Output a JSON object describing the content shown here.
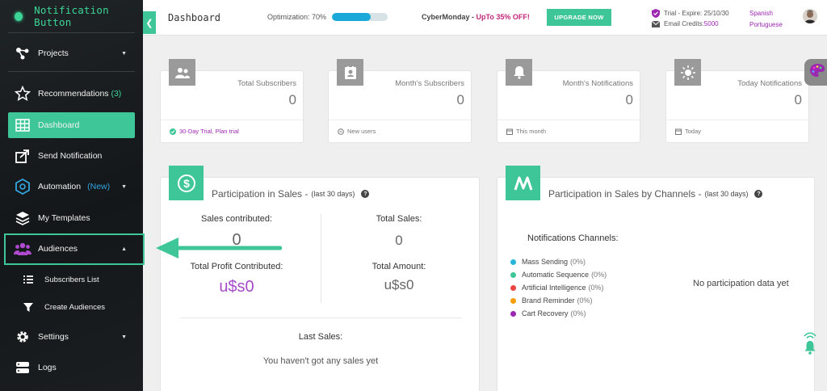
{
  "brand": {
    "name": "Notification Button",
    "color": "#3dd597"
  },
  "sidebar": {
    "projects": "Projects",
    "recommendations": "Recommendations",
    "recommendations_count": "(3)",
    "dashboard": "Dashboard",
    "send_notification": "Send Notification",
    "automation": "Automation",
    "automation_badge": "(New)",
    "my_templates": "My Templates",
    "audiences": "Audiences",
    "subscribers_list": "Subscribers List",
    "create_audiences": "Create Audiences",
    "settings": "Settings",
    "logs": "Logs"
  },
  "topbar": {
    "title": "Dashboard",
    "optimization_label": "Optimization: 70%",
    "optimization_value": 0.7,
    "promo_prefix": "CyberMonday - ",
    "promo_offer": "UpTo 35% OFF!",
    "upgrade": "UPGRADE NOW",
    "trial_label": "Trial - Expire: 25/10/30",
    "credits_label": "Email Credits: ",
    "credits_value": "5000",
    "lang_1": "Spanish",
    "lang_2": "Portuguese"
  },
  "stats": [
    {
      "label": "Total Subscribers",
      "value": "0",
      "footer": "30-Day Trial, Plan trial",
      "icon": "people-icon"
    },
    {
      "label": "Month's Subscribers",
      "value": "0",
      "footer": "New users",
      "icon": "contact-card-icon"
    },
    {
      "label": "Month's Notifications",
      "value": "0",
      "footer": "This month",
      "icon": "bell-icon"
    },
    {
      "label": "Today Notifications",
      "value": "0",
      "footer": "Today",
      "icon": "sun-icon"
    }
  ],
  "sales": {
    "title": "Participation in Sales - ",
    "period": "(last 30 days)",
    "help": "?",
    "contributed_label": "Sales contributed:",
    "contributed_value": "0",
    "total_sales_label": "Total Sales:",
    "total_sales_value": "0",
    "profit_label": "Total Profit Contributed:",
    "profit_value": "u$s0",
    "amount_label": "Total Amount:",
    "amount_value": "u$s0",
    "last_sales_label": "Last Sales:",
    "no_sales": "You haven't got any sales yet"
  },
  "channels": {
    "title": "Participation in Sales by Channels - ",
    "period": "(last 30 days)",
    "help": "?",
    "head": "Notifications Channels:",
    "items": [
      {
        "name": "Mass Sending",
        "pct": "(0%)",
        "color": "#26b5d8"
      },
      {
        "name": "Automatic Sequence",
        "pct": "(0%)",
        "color": "#3ec598"
      },
      {
        "name": "Artificial Intelligence",
        "pct": "(0%)",
        "color": "#ef4444"
      },
      {
        "name": "Brand Reminder",
        "pct": "(0%)",
        "color": "#f59e0b"
      },
      {
        "name": "Cart Recovery",
        "pct": "(0%)",
        "color": "#9c27b0"
      }
    ],
    "empty": "No participation data yet"
  },
  "colors": {
    "accent": "#3ec598",
    "purple": "#9c27b0",
    "progress": "#1aa9d8"
  }
}
